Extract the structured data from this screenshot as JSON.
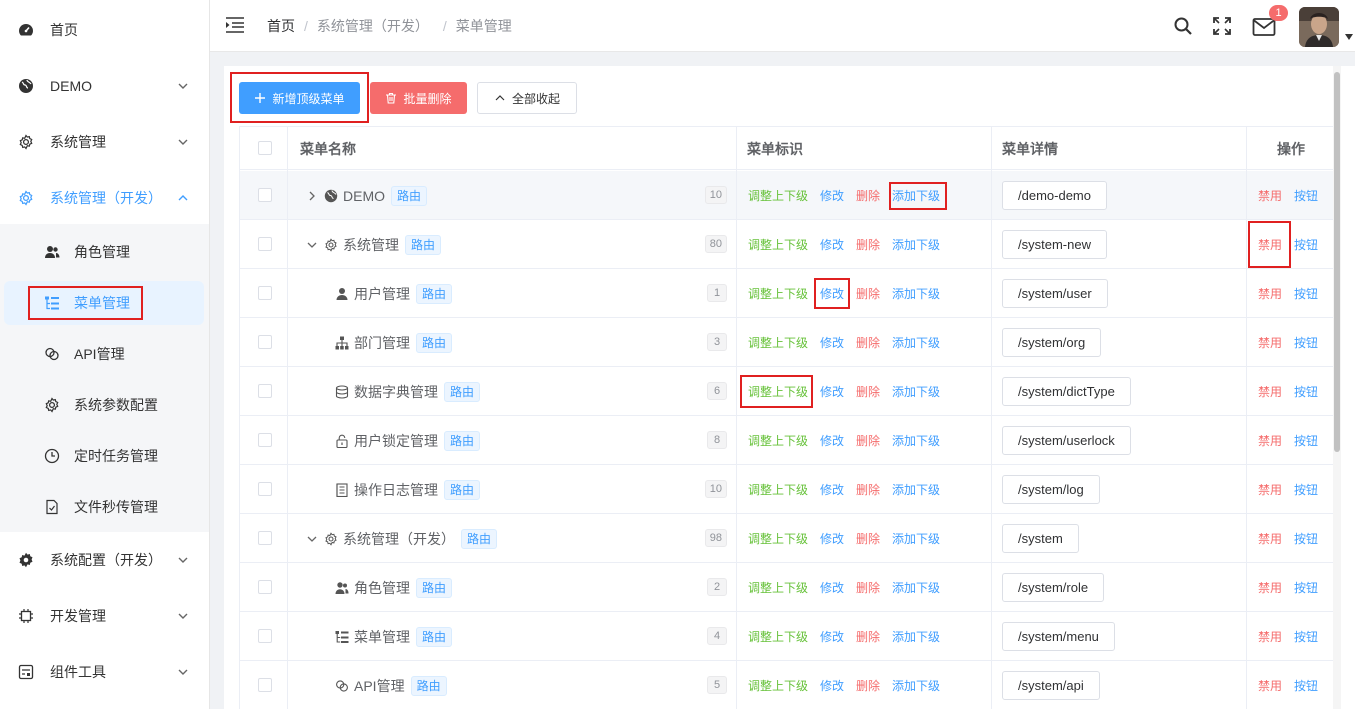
{
  "sidebar": {
    "items": [
      {
        "label": "首页",
        "icon": "dashboard-icon"
      },
      {
        "label": "DEMO",
        "icon": "globe-icon"
      },
      {
        "label": "系统管理",
        "icon": "gear-icon"
      },
      {
        "label": "系统管理（开发）",
        "icon": "gear-icon"
      },
      {
        "label": "系统配置（开发）",
        "icon": "cog-icon"
      },
      {
        "label": "开发管理",
        "icon": "chip-icon"
      },
      {
        "label": "组件工具",
        "icon": "toolbox-icon"
      }
    ],
    "subitems": [
      {
        "label": "角色管理",
        "icon": "users-icon"
      },
      {
        "label": "菜单管理",
        "icon": "tree-list-icon"
      },
      {
        "label": "API管理",
        "icon": "link-icon"
      },
      {
        "label": "系统参数配置",
        "icon": "gear-icon"
      },
      {
        "label": "定时任务管理",
        "icon": "clock-icon"
      },
      {
        "label": "文件秒传管理",
        "icon": "file-check-icon"
      }
    ]
  },
  "header": {
    "breadcrumb": [
      "首页",
      "系统管理（开发）",
      "菜单管理"
    ],
    "notification_count": "1"
  },
  "toolbar": {
    "add_top_menu": "新增顶级菜单",
    "batch_delete": "批量删除",
    "collapse_all": "全部收起"
  },
  "table": {
    "columns": [
      "菜单名称",
      "菜单标识",
      "菜单详情",
      "操作"
    ],
    "actions": {
      "adjust": "调整上下级",
      "edit": "修改",
      "delete": "删除",
      "add_child": "添加下级",
      "disable": "禁用",
      "button": "按钮"
    },
    "route_tag": "路由",
    "rows": [
      {
        "name": "DEMO",
        "sort": "10",
        "path": "/demo-demo",
        "icon": "globe-icon",
        "level": 0,
        "expander": "right"
      },
      {
        "name": "系统管理",
        "sort": "80",
        "path": "/system-new",
        "icon": "gear-icon",
        "level": 0,
        "expander": "down"
      },
      {
        "name": "用户管理",
        "sort": "1",
        "path": "/system/user",
        "icon": "user-icon",
        "level": 1
      },
      {
        "name": "部门管理",
        "sort": "3",
        "path": "/system/org",
        "icon": "org-chart-icon",
        "level": 1
      },
      {
        "name": "数据字典管理",
        "sort": "6",
        "path": "/system/dictType",
        "icon": "database-icon",
        "level": 1
      },
      {
        "name": "用户锁定管理",
        "sort": "8",
        "path": "/system/userlock",
        "icon": "lock-icon",
        "level": 1
      },
      {
        "name": "操作日志管理",
        "sort": "10",
        "path": "/system/log",
        "icon": "log-icon",
        "level": 1
      },
      {
        "name": "系统管理（开发）",
        "sort": "98",
        "path": "/system",
        "icon": "gear-icon",
        "level": 0,
        "expander": "down"
      },
      {
        "name": "角色管理",
        "sort": "2",
        "path": "/system/role",
        "icon": "users-icon",
        "level": 1
      },
      {
        "name": "菜单管理",
        "sort": "4",
        "path": "/system/menu",
        "icon": "tree-list-icon",
        "level": 1
      },
      {
        "name": "API管理",
        "sort": "5",
        "path": "/system/api",
        "icon": "link-icon",
        "level": 1
      }
    ]
  }
}
